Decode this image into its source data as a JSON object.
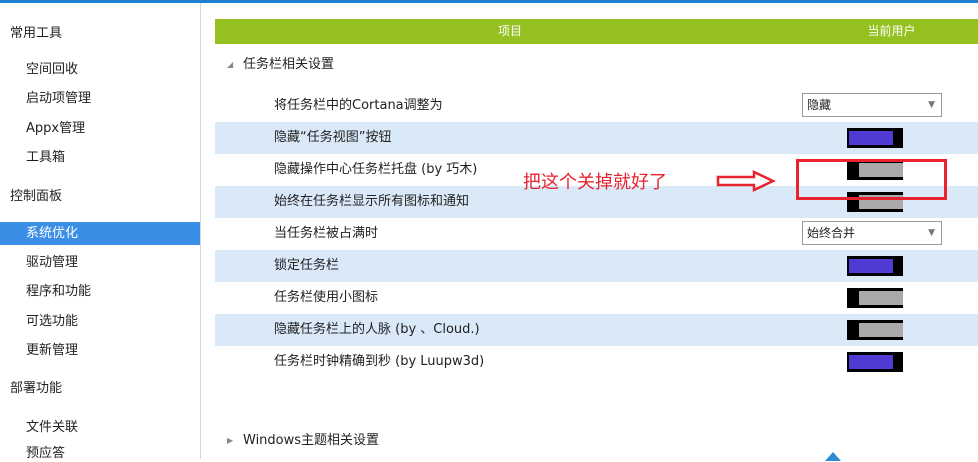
{
  "sidebar": {
    "items": [
      {
        "label": "常用工具",
        "type": "section",
        "selected": false
      },
      {
        "label": "空间回收",
        "type": "sub",
        "selected": false
      },
      {
        "label": "启动项管理",
        "type": "sub",
        "selected": false
      },
      {
        "label": "Appx管理",
        "type": "sub",
        "selected": false
      },
      {
        "label": "工具箱",
        "type": "sub",
        "selected": false
      },
      {
        "label": "控制面板",
        "type": "section",
        "selected": false
      },
      {
        "label": "系统优化",
        "type": "sub",
        "selected": true
      },
      {
        "label": "驱动管理",
        "type": "sub",
        "selected": false
      },
      {
        "label": "程序和功能",
        "type": "sub",
        "selected": false
      },
      {
        "label": "可选功能",
        "type": "sub",
        "selected": false
      },
      {
        "label": "更新管理",
        "type": "sub",
        "selected": false
      },
      {
        "label": "部署功能",
        "type": "section",
        "selected": false
      },
      {
        "label": "文件关联",
        "type": "sub",
        "selected": false
      },
      {
        "label": "预应答",
        "type": "sub",
        "selected": false
      }
    ]
  },
  "header": {
    "item_col": "项目",
    "user_col": "当前用户"
  },
  "groups": [
    {
      "label": "任务栏相关设置",
      "expanded": true
    },
    {
      "label": "Windows主题相关设置",
      "expanded": false
    }
  ],
  "rows": [
    {
      "label": "将任务栏中的Cortana调整为",
      "control": "dropdown",
      "value": "隐藏"
    },
    {
      "label": "隐藏“任务视图”按钮",
      "control": "toggle",
      "state": "on"
    },
    {
      "label": "隐藏操作中心任务栏托盘 (by 巧木)",
      "control": "toggle",
      "state": "off"
    },
    {
      "label": "始终在任务栏显示所有图标和通知",
      "control": "toggle",
      "state": "off"
    },
    {
      "label": "当任务栏被占满时",
      "control": "dropdown",
      "value": "始终合并"
    },
    {
      "label": "锁定任务栏",
      "control": "toggle",
      "state": "on"
    },
    {
      "label": "任务栏使用小图标",
      "control": "toggle",
      "state": "off"
    },
    {
      "label": "隐藏任务栏上的人脉 (by 、Cloud.)",
      "control": "toggle",
      "state": "off"
    },
    {
      "label": "任务栏时钟精确到秒 (by Luupw3d)",
      "control": "toggle",
      "state": "on"
    }
  ],
  "annotation": {
    "text": "把这个关掉就好了",
    "color": "#e8232e"
  },
  "colors": {
    "header_bg": "#94c11f",
    "selected_bg": "#3a8ee6",
    "alt_row_bg": "#dae9f7",
    "toggle_on": "#4f3ad4",
    "toggle_off": "#aaaaaa",
    "accent": "#1e7fd0"
  },
  "icons": {
    "expanded_group": "triangle-down-icon",
    "collapsed_group": "triangle-right-icon",
    "dropdown": "chevron-down-icon",
    "watermark": "logo-icon"
  }
}
